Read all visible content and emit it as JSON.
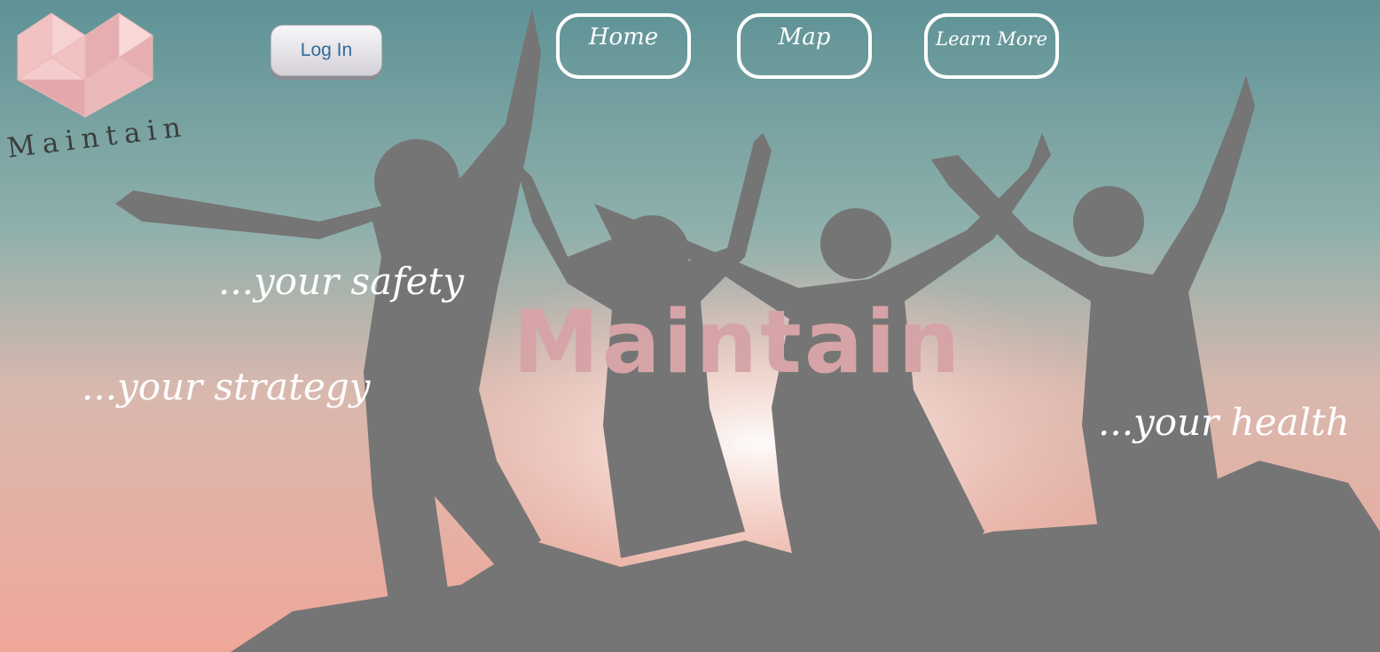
{
  "brand": {
    "logo_text": "Maintain"
  },
  "auth": {
    "login_label": "Log In"
  },
  "nav": {
    "items": [
      {
        "label": "Home"
      },
      {
        "label": "Map"
      },
      {
        "label": "Learn More"
      }
    ]
  },
  "hero": {
    "title": "Maintain",
    "taglines": [
      "...your safety",
      "...your strategy",
      "...your health"
    ]
  },
  "colors": {
    "title_pink": "#d6a4a6",
    "silhouette": "#757575",
    "logo_pink": "#f2c2c2"
  }
}
